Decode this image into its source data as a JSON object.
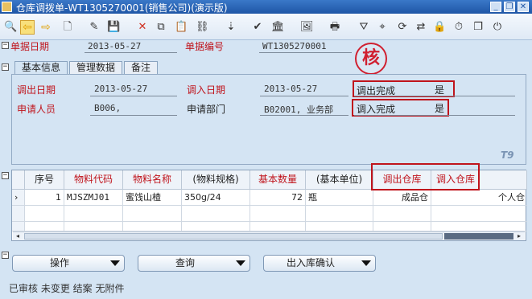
{
  "window": {
    "title": "仓库调拨单-WT1305270001(销售公司)(演示版)",
    "minimize": "_",
    "restore": "❐",
    "close": "✕"
  },
  "toolbar": {
    "icons": [
      "preview-icon",
      "back-arrow-icon",
      "forward-arrow-icon",
      "new-doc-icon",
      "edit-icon",
      "save-icon",
      "delete-icon",
      "copy-icon",
      "paste-icon",
      "link-icon",
      "import-icon",
      "check-icon",
      "audit-icon",
      "picture-icon",
      "print-icon",
      "filter-icon",
      "locate-icon",
      "refresh-icon",
      "lock-icon",
      "clock-icon",
      "copy-window-icon",
      "exit-icon"
    ]
  },
  "header": {
    "date_label": "单据日期",
    "date_value": "2013-05-27",
    "number_label": "单据编号",
    "number_value": "WT1305270001"
  },
  "stamp": {
    "text": "核"
  },
  "tabs": [
    {
      "label": "基本信息",
      "selected": true
    },
    {
      "label": "管理数据",
      "selected": false
    },
    {
      "label": "备注",
      "selected": false
    }
  ],
  "basic": {
    "out_date_label": "调出日期",
    "out_date_value": "2013-05-27",
    "in_date_label": "调入日期",
    "in_date_value": "2013-05-27",
    "out_done_label": "调出完成",
    "out_done_value": "是",
    "applicant_label": "申请人员",
    "applicant_value": "B006,",
    "dept_label": "申请部门",
    "dept_value": "B02001, 业务部",
    "in_done_label": "调入完成",
    "in_done_value": "是",
    "watermark": "T9"
  },
  "grid": {
    "columns": [
      "序号",
      "物料代码",
      "物料名称",
      "(物料规格)",
      "基本数量",
      "(基本单位)",
      "调出仓库",
      "调入仓库"
    ],
    "rows": [
      {
        "seq": "1",
        "code": "MJSZMJ01",
        "name": "蜜饯山楂",
        "spec": "350g/24",
        "qty": "72",
        "unit": "瓶",
        "out_wh": "成品仓",
        "in_wh": "个人仓"
      }
    ]
  },
  "buttons": {
    "operate": "操作",
    "query": "查询",
    "confirm": "出入库确认"
  },
  "status": "已审核  未变更  结案  无附件"
}
